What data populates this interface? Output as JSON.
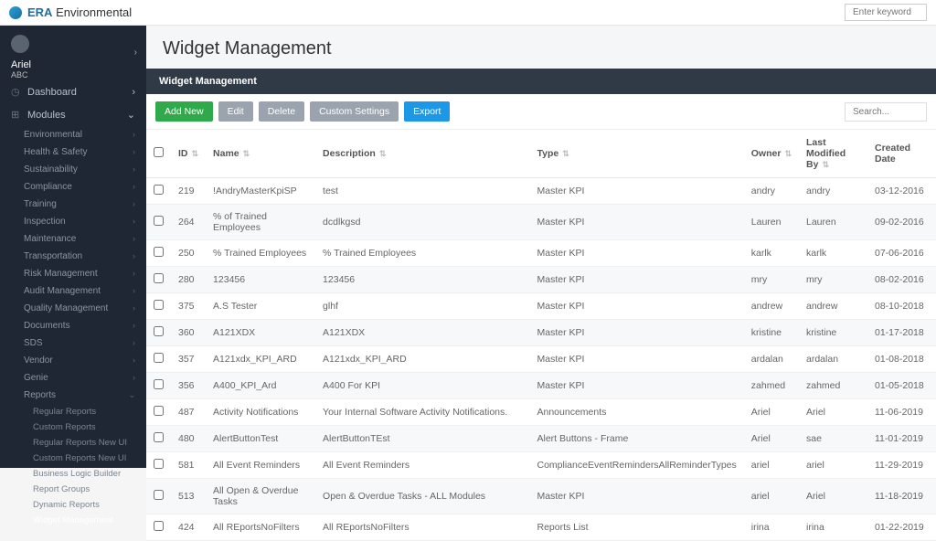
{
  "brand": {
    "prefix": "ERA",
    "suffix": "Environmental"
  },
  "topSearchPlaceholder": "Enter keyword",
  "user": {
    "name": "Ariel",
    "org": "ABC"
  },
  "sideMain": [
    {
      "icon": "◷",
      "label": "Dashboard",
      "open": false
    },
    {
      "icon": "⊞",
      "label": "Modules",
      "open": true
    }
  ],
  "modules": [
    "Environmental",
    "Health & Safety",
    "Sustainability",
    "Compliance",
    "Training",
    "Inspection",
    "Maintenance",
    "Transportation",
    "Risk Management",
    "Audit Management",
    "Quality Management",
    "Documents",
    "SDS",
    "Vendor",
    "Genie"
  ],
  "reportsLabel": "Reports",
  "reportsChildren": [
    "Regular Reports",
    "Custom Reports",
    "Regular Reports New UI",
    "Custom Reports New UI",
    "Business Logic Builder",
    "Report Groups",
    "Dynamic Reports",
    "Widget Management"
  ],
  "page": {
    "title": "Widget Management",
    "panelHeader": "Widget Management"
  },
  "toolbar": {
    "addNew": "Add New",
    "edit": "Edit",
    "delete": "Delete",
    "custom": "Custom Settings",
    "export": "Export",
    "searchPlaceholder": "Search..."
  },
  "columns": {
    "id": "ID",
    "name": "Name",
    "description": "Description",
    "type": "Type",
    "owner": "Owner",
    "modBy": "Last Modified By",
    "created": "Created Date"
  },
  "rows": [
    {
      "id": "219",
      "name": "!AndryMasterKpiSP",
      "desc": "test",
      "type": "Master KPI",
      "owner": "andry",
      "mod": "andry",
      "date": "03-12-2016"
    },
    {
      "id": "264",
      "name": "% of Trained Employees",
      "desc": "dcdlkgsd",
      "type": "Master KPI",
      "owner": "Lauren",
      "mod": "Lauren",
      "date": "09-02-2016"
    },
    {
      "id": "250",
      "name": "% Trained Employees",
      "desc": "% Trained Employees",
      "type": "Master KPI",
      "owner": "karlk",
      "mod": "karlk",
      "date": "07-06-2016"
    },
    {
      "id": "280",
      "name": "123456",
      "desc": "123456",
      "type": "Master KPI",
      "owner": "mry",
      "mod": "mry",
      "date": "08-02-2016"
    },
    {
      "id": "375",
      "name": "A.S Tester",
      "desc": "glhf",
      "type": "Master KPI",
      "owner": "andrew",
      "mod": "andrew",
      "date": "08-10-2018"
    },
    {
      "id": "360",
      "name": "A121XDX",
      "desc": "A121XDX",
      "type": "Master KPI",
      "owner": "kristine",
      "mod": "kristine",
      "date": "01-17-2018"
    },
    {
      "id": "357",
      "name": "A121xdx_KPI_ARD",
      "desc": "A121xdx_KPI_ARD",
      "type": "Master KPI",
      "owner": "ardalan",
      "mod": "ardalan",
      "date": "01-08-2018"
    },
    {
      "id": "356",
      "name": "A400_KPI_Ard",
      "desc": "A400 For KPI",
      "type": "Master KPI",
      "owner": "zahmed",
      "mod": "zahmed",
      "date": "01-05-2018"
    },
    {
      "id": "487",
      "name": "Activity Notifications",
      "desc": "Your Internal Software Activity Notifications.",
      "type": "Announcements",
      "owner": "Ariel",
      "mod": "Ariel",
      "date": "11-06-2019"
    },
    {
      "id": "480",
      "name": "AlertButtonTest",
      "desc": "AlertButtonTEst",
      "type": "Alert Buttons - Frame",
      "owner": "Ariel",
      "mod": "sae",
      "date": "11-01-2019"
    },
    {
      "id": "581",
      "name": "All Event Reminders",
      "desc": "All Event Reminders",
      "type": "ComplianceEventRemindersAllReminderTypes",
      "owner": "ariel",
      "mod": "ariel",
      "date": "11-29-2019"
    },
    {
      "id": "513",
      "name": "All Open & Overdue Tasks",
      "desc": "Open & Overdue Tasks - ALL Modules",
      "type": "Master KPI",
      "owner": "ariel",
      "mod": "Ariel",
      "date": "11-18-2019"
    },
    {
      "id": "424",
      "name": "All REportsNoFilters",
      "desc": "All REportsNoFilters",
      "type": "Reports List",
      "owner": "irina",
      "mod": "irina",
      "date": "01-22-2019"
    }
  ]
}
